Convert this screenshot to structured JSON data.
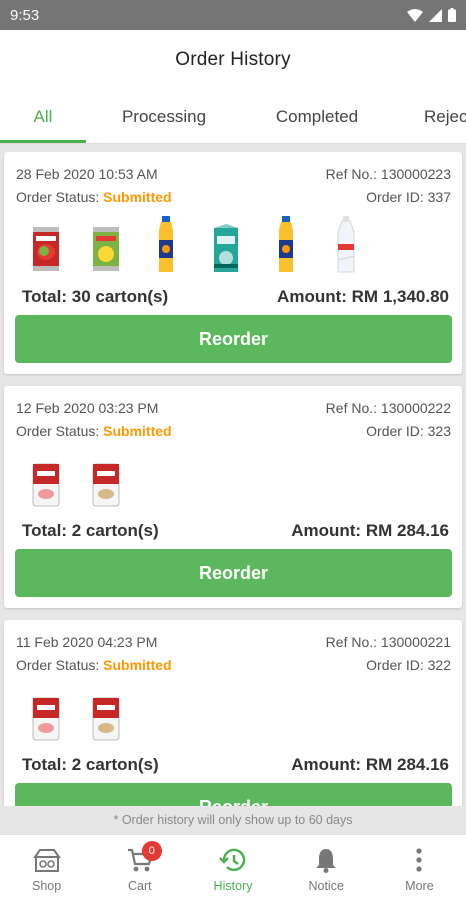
{
  "status_bar": {
    "time": "9:53"
  },
  "header": {
    "title": "Order History"
  },
  "tabs": [
    {
      "label": "All",
      "active": true
    },
    {
      "label": "Processing",
      "active": false
    },
    {
      "label": "Completed",
      "active": false
    },
    {
      "label": "Rejected",
      "active": false
    }
  ],
  "orders": [
    {
      "date": "28 Feb 2020 10:53 AM",
      "ref_label": "Ref No.:",
      "ref": "130000223",
      "status_label": "Order Status:",
      "status": "Submitted",
      "order_id_label": "Order ID:",
      "order_id": "337",
      "products": [
        "red-juice-can",
        "yellow-juice-can",
        "orange-juice-bottle",
        "green-juice-carton",
        "orange-juice-bottle",
        "water-bottle"
      ],
      "total_label": "Total:",
      "total": "30 carton(s)",
      "amount_label": "Amount:",
      "amount": "RM 1,340.80",
      "reorder_label": "Reorder"
    },
    {
      "date": "12 Feb 2020 03:23 PM",
      "ref_label": "Ref No.:",
      "ref": "130000222",
      "status_label": "Order Status:",
      "status": "Submitted",
      "order_id_label": "Order ID:",
      "order_id": "323",
      "products": [
        "soup-can-red",
        "soup-can-cream"
      ],
      "total_label": "Total:",
      "total": "2 carton(s)",
      "amount_label": "Amount:",
      "amount": "RM 284.16",
      "reorder_label": "Reorder"
    },
    {
      "date": "11 Feb 2020 04:23 PM",
      "ref_label": "Ref No.:",
      "ref": "130000221",
      "status_label": "Order Status:",
      "status": "Submitted",
      "order_id_label": "Order ID:",
      "order_id": "322",
      "products": [
        "soup-can-red",
        "soup-can-cream"
      ],
      "total_label": "Total:",
      "total": "2 carton(s)",
      "amount_label": "Amount:",
      "amount": "RM 284.16",
      "reorder_label": "Reorder"
    }
  ],
  "footnote": "* Order history will only show up to 60 days",
  "bottom_nav": [
    {
      "label": "Shop",
      "icon": "shop-icon",
      "active": false
    },
    {
      "label": "Cart",
      "icon": "cart-icon",
      "active": false,
      "badge": "0"
    },
    {
      "label": "History",
      "icon": "history-icon",
      "active": true
    },
    {
      "label": "Notice",
      "icon": "bell-icon",
      "active": false
    },
    {
      "label": "More",
      "icon": "more-vertical-icon",
      "active": false
    }
  ],
  "colors": {
    "accent": "#4caf50",
    "button": "#5cb85c",
    "status": "#ff9800",
    "badge": "#e53935"
  }
}
